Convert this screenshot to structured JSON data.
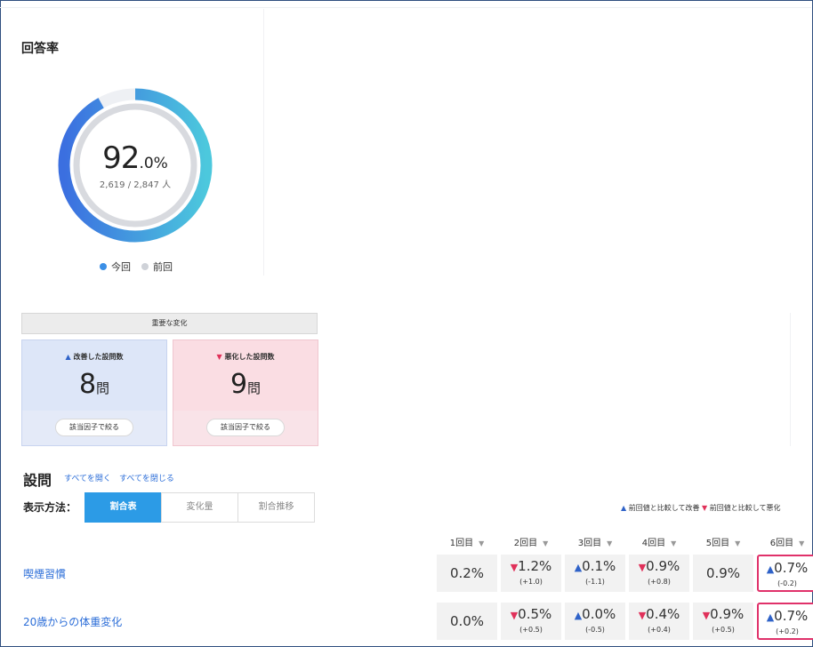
{
  "rate": {
    "title": "回答率",
    "value": "92",
    "unit": ".0%",
    "detail": "2,619 / 2,847 人",
    "current_fraction": 0.92,
    "colors": {
      "current_start": "#3b6fe0",
      "current_end": "#4cc8dd",
      "previous": "#d8dadf",
      "track": "#eef0f4"
    },
    "legend": [
      {
        "label": "今回",
        "color": "#3b8fe6"
      },
      {
        "label": "前回",
        "color": "#cfd2d8"
      }
    ]
  },
  "changes": {
    "header": "重要な変化",
    "improved": {
      "label": "改善した設問数",
      "count": "8",
      "unit": "問",
      "button": "該当因子で絞る"
    },
    "worsened": {
      "label": "悪化した設問数",
      "count": "9",
      "unit": "問",
      "button": "該当因子で絞る"
    }
  },
  "questions": {
    "title": "設問",
    "expand_all": "すべてを開く",
    "collapse_all": "すべてを閉じる",
    "display_label": "表示方法：",
    "modes": [
      "割合表",
      "変化量",
      "割合推移"
    ],
    "active_mode": "割合表",
    "legend_up": "前回値と比較して改善",
    "legend_down": "前回値と比較して悪化",
    "columns": [
      "1回目",
      "2回目",
      "3回目",
      "4回目",
      "5回目",
      "6回目"
    ],
    "rows": [
      {
        "label": "喫煙習慣",
        "cells": [
          {
            "value": "0.2%",
            "trend": "",
            "delta": ""
          },
          {
            "value": "1.2%",
            "trend": "down",
            "delta": "(+1.0)"
          },
          {
            "value": "0.1%",
            "trend": "up",
            "delta": "(-1.1)"
          },
          {
            "value": "0.9%",
            "trend": "down",
            "delta": "(+0.8)"
          },
          {
            "value": "0.9%",
            "trend": "",
            "delta": ""
          },
          {
            "value": "0.7%",
            "trend": "up",
            "delta": "(-0.2)"
          }
        ]
      },
      {
        "label": "20歳からの体重変化",
        "cells": [
          {
            "value": "0.0%",
            "trend": "",
            "delta": ""
          },
          {
            "value": "0.5%",
            "trend": "down",
            "delta": "(+0.5)"
          },
          {
            "value": "0.0%",
            "trend": "up",
            "delta": "(-0.5)"
          },
          {
            "value": "0.4%",
            "trend": "down",
            "delta": "(+0.4)"
          },
          {
            "value": "0.9%",
            "trend": "down",
            "delta": "(+0.5)"
          },
          {
            "value": "0.7%",
            "trend": "up",
            "delta": "(+0.2)"
          }
        ]
      }
    ]
  }
}
